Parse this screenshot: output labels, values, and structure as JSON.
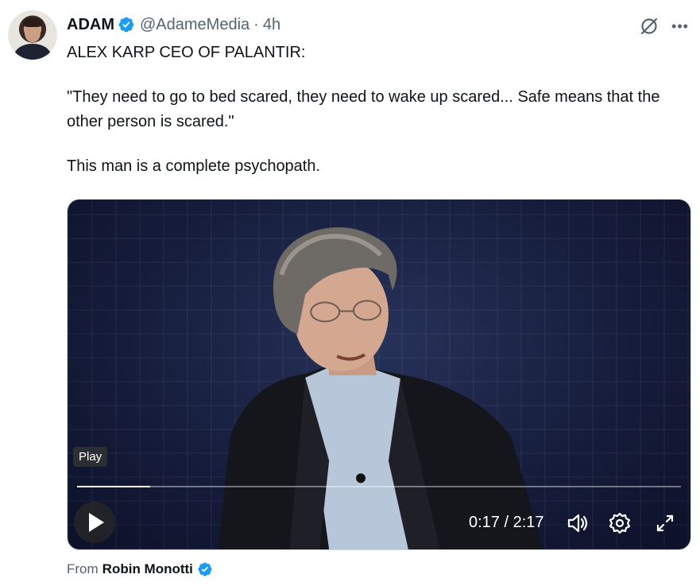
{
  "author": {
    "name": "ADAM",
    "handle": "@AdameMedia",
    "separator": "·",
    "time": "4h"
  },
  "tweet": {
    "line1": "ALEX KARP CEO OF PALANTIR:",
    "quote": "\"They need to go to bed scared, they need to wake up scared... Safe means that the other person is scared.\"",
    "line3": "This man is a complete psychopath."
  },
  "video": {
    "tooltip": "Play",
    "time_display": "0:17 / 2:17",
    "progress_fraction": 0.121
  },
  "source": {
    "prefix": "From",
    "name": "Robin Monotti"
  },
  "icons": {
    "verified": "verified-badge-icon",
    "grok": "grok-icon",
    "more": "more-icon",
    "play": "play-icon",
    "volume": "volume-icon",
    "settings": "settings-gear-icon",
    "fullscreen": "fullscreen-icon"
  },
  "colors": {
    "verified_blue": "#1d9bf0",
    "secondary_text": "#536471",
    "primary_text": "#0f1419"
  }
}
